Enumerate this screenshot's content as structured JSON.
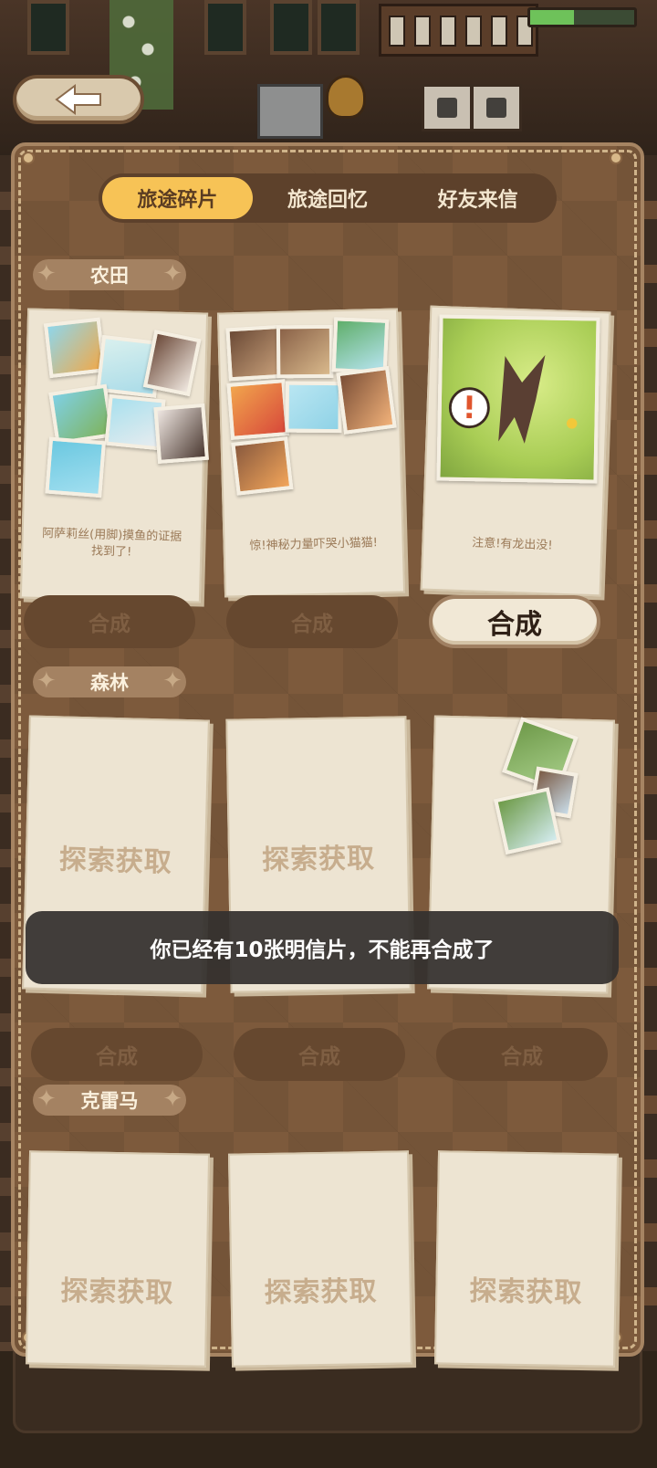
{
  "hud": {
    "progress_fraction": 0.42,
    "progress_color": "#6ec25a"
  },
  "back_button": {
    "icon": "arrow-left-icon"
  },
  "tabs": [
    {
      "label": "旅途碎片",
      "active": true
    },
    {
      "label": "旅途回忆",
      "active": false
    },
    {
      "label": "好友来信",
      "active": false
    }
  ],
  "sections": [
    {
      "title": "农田",
      "cards": [
        {
          "caption_line1": "阿萨莉丝(用脚)摸鱼的证据",
          "caption_line2": "找到了!",
          "craft_label": "合成",
          "craft_enabled": false
        },
        {
          "caption_line1": "惊!神秘力量吓哭小猫猫!",
          "caption_line2": "",
          "craft_label": "合成",
          "craft_enabled": false
        },
        {
          "caption_line1": "注意!有龙出没!",
          "caption_line2": "",
          "craft_label": "合成",
          "craft_enabled": true
        }
      ]
    },
    {
      "title": "森林",
      "cards": [
        {
          "explore_label": "探索获取",
          "craft_label": "合成",
          "craft_enabled": false
        },
        {
          "explore_label": "探索获取",
          "craft_label": "合成",
          "craft_enabled": false
        },
        {
          "explore_label": "",
          "craft_label": "合成",
          "craft_enabled": false
        }
      ]
    },
    {
      "title": "克雷马",
      "cards": [
        {
          "explore_label": "探索获取"
        },
        {
          "explore_label": "探索获取"
        },
        {
          "explore_label": "探索获取"
        }
      ]
    }
  ],
  "toast": {
    "message": "你已经有10张明信片，不能再合成了"
  },
  "colors": {
    "panel": "#7d5a3c",
    "tab_active": "#f7c356",
    "card": "#ede4d2",
    "craft_disabled": "#66482f"
  }
}
